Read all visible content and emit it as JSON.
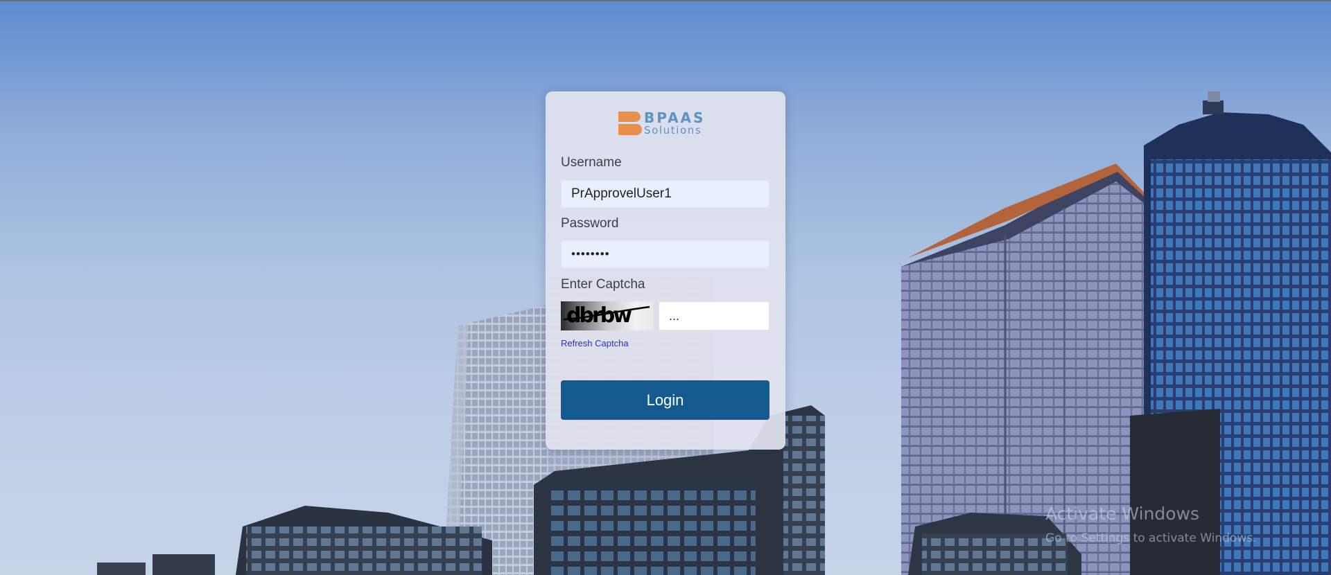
{
  "brand": {
    "name": "BPAAS",
    "tagline": "Solutions",
    "accent_color": "#e8904a",
    "text_color": "#5b93c4"
  },
  "form": {
    "username_label": "Username",
    "username_value": "PrApprovelUser1",
    "password_label": "Password",
    "password_value": "••••••••",
    "captcha_label": "Enter Captcha",
    "captcha_image_text": "dbrbw",
    "captcha_input_value": "...",
    "refresh_link": "Refresh Captcha",
    "login_button": "Login",
    "button_color": "#135a8e"
  },
  "watermark": {
    "title": "Activate Windows",
    "subtitle": "Go to Settings to activate Windows."
  }
}
